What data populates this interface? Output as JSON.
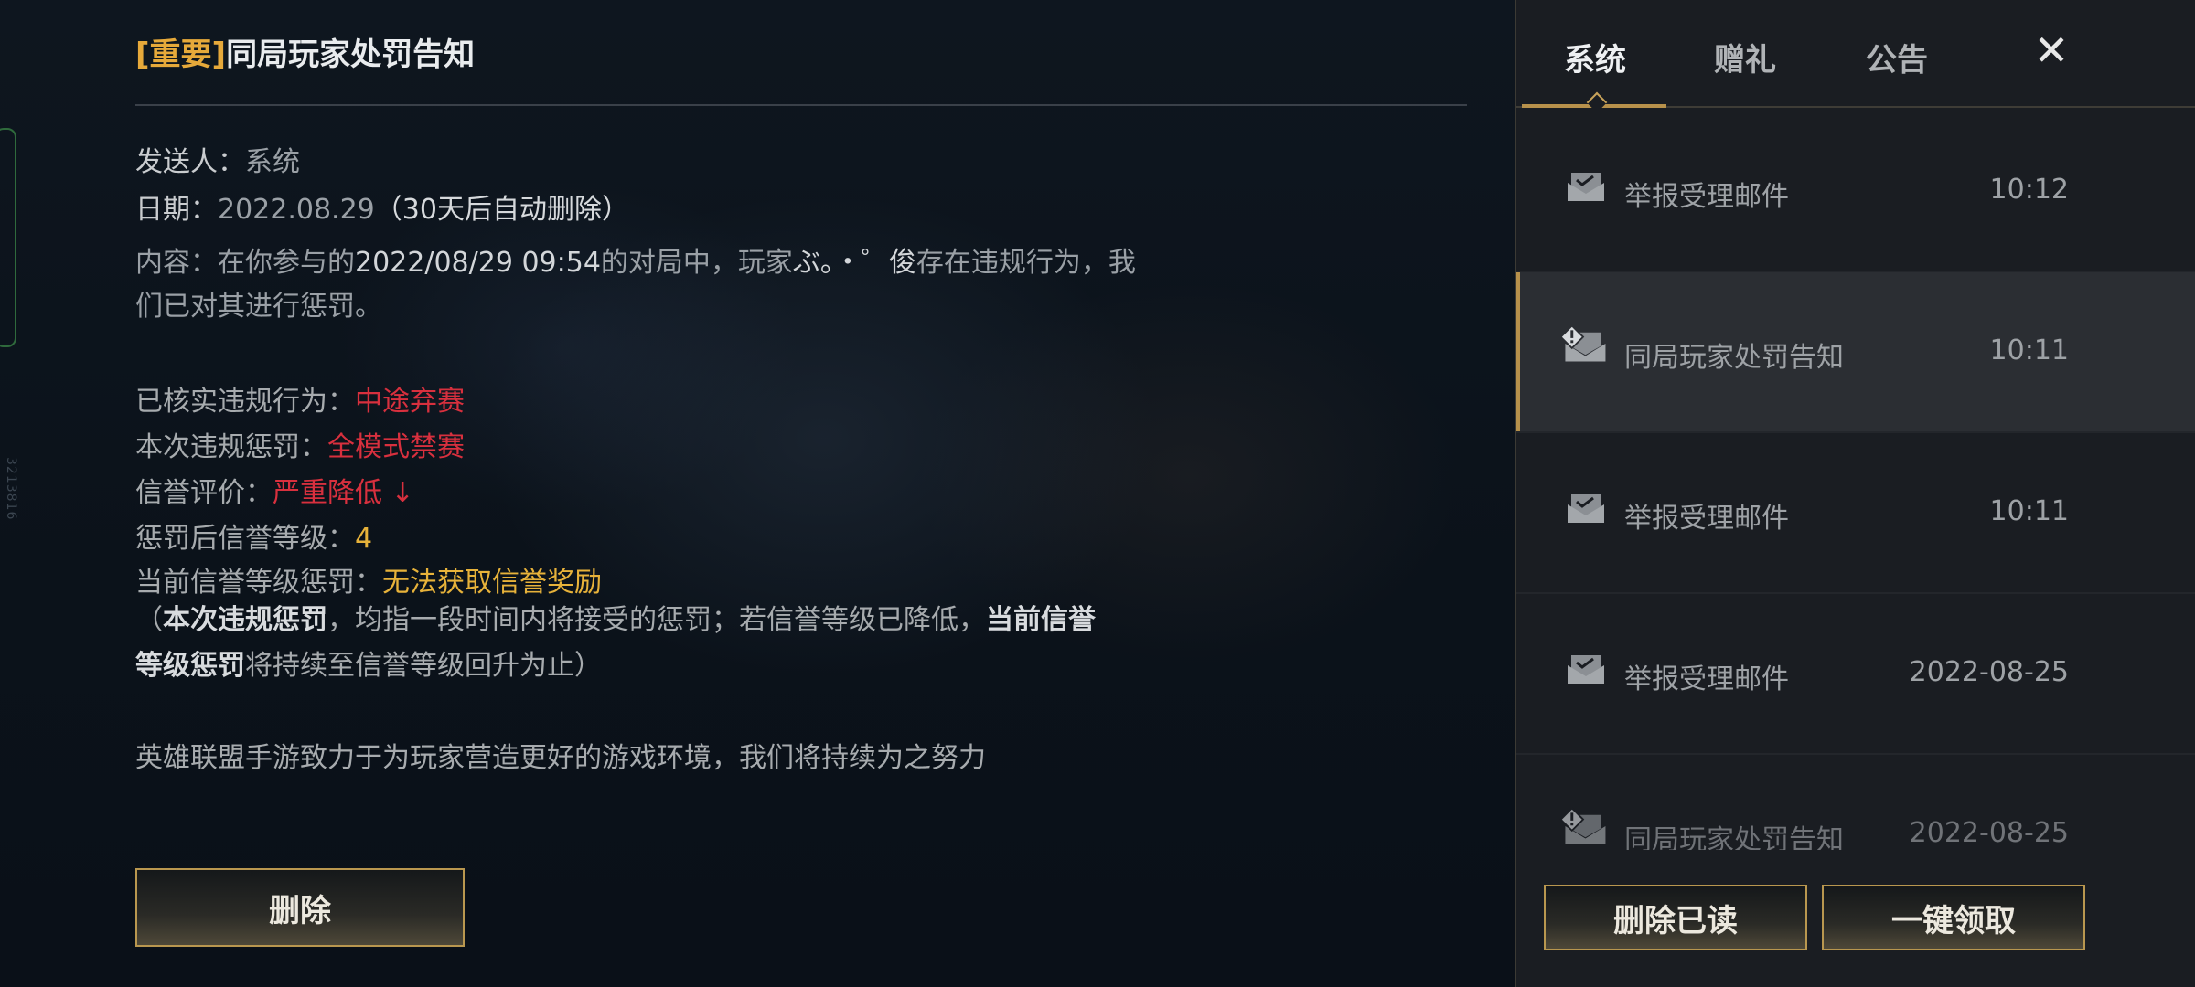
{
  "detail": {
    "title_tag": "[重要]",
    "title": "同局玩家处罚告知",
    "sender_label": "发送人：",
    "sender_value": "系统",
    "date_label": "日期：",
    "date_value": "2022.08.29",
    "date_note": "（30天后自动删除）",
    "content_label": "内容：",
    "content_part1": "在你参与的",
    "content_datetime": "2022/08/29 09:54",
    "content_part2": "的对局中，玩家",
    "content_player": "ぶ。・゜俊",
    "content_part3": "存在违规行为，我们已对其进行惩罚。",
    "violation_label": "已核实违规行为：",
    "violation_value": "中途弃赛",
    "penalty_label": "本次违规惩罚：",
    "penalty_value": "全模式禁赛",
    "credit_label": "信誉评价：",
    "credit_value": "严重降低 ↓",
    "credit_level_label": "惩罚后信誉等级：",
    "credit_level_value": "4",
    "current_penalty_label": "当前信誉等级惩罚：",
    "current_penalty_value": "无法获取信誉奖励",
    "note_open": "（",
    "note_bold1": "本次违规惩罚",
    "note_mid": "，均指一段时间内将接受的惩罚；若信誉等级已降低，",
    "note_bold2": "当前信誉等级惩罚",
    "note_end": "将持续至信誉等级回升为止）",
    "footer": "英雄联盟手游致力于为玩家营造更好的游戏环境，我们将持续为之努力",
    "delete_label": "删除"
  },
  "side_id": "3213816",
  "tabs": [
    {
      "label": "系统",
      "active": true
    },
    {
      "label": "赠礼",
      "active": false
    },
    {
      "label": "公告",
      "active": false
    }
  ],
  "close_icon": "close-icon",
  "mails": [
    {
      "icon": "mail-icon",
      "label": "举报受理邮件",
      "time": "10:12"
    },
    {
      "icon": "mail-alert-icon",
      "label": "同局玩家处罚告知",
      "time": "10:11"
    },
    {
      "icon": "mail-icon",
      "label": "举报受理邮件",
      "time": "10:11"
    },
    {
      "icon": "mail-icon",
      "label": "举报受理邮件",
      "time": "2022-08-25"
    },
    {
      "icon": "mail-alert-icon",
      "label": "同局玩家处罚告知",
      "time": "2022-08-25"
    }
  ],
  "buttons": {
    "clear_read": "删除已读",
    "claim_all": "一键领取"
  },
  "colors": {
    "accent_gold": "#b7914b",
    "alert_red": "#d8303e",
    "highlight_gold": "#e7b23a",
    "tag_gold": "#e6a93a"
  }
}
